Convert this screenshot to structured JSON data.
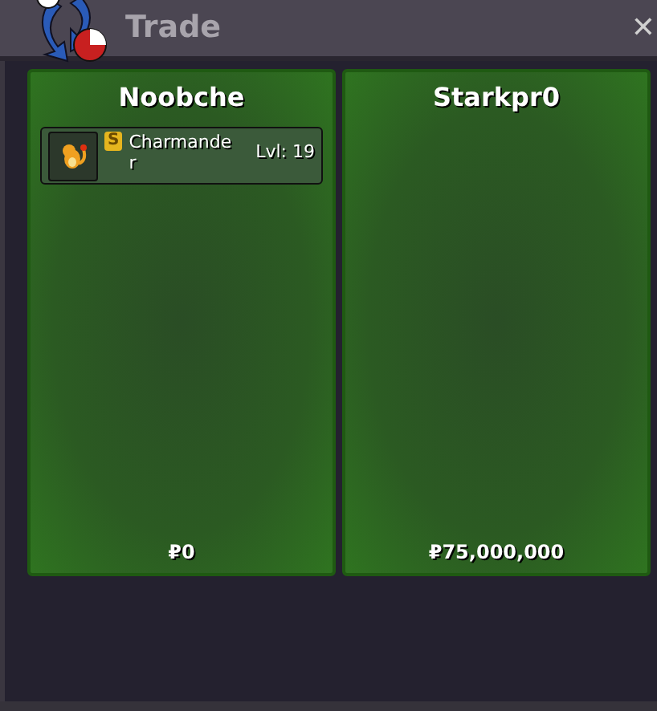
{
  "window": {
    "title": "Trade",
    "close": "✕"
  },
  "sides": [
    {
      "player": "Noobche",
      "money": "₽0",
      "offers": [
        {
          "badge": "S",
          "name": "Charmander",
          "level": "Lvl: 19"
        }
      ]
    },
    {
      "player": "Starkpr0",
      "money": "₽75,000,000"
    }
  ]
}
